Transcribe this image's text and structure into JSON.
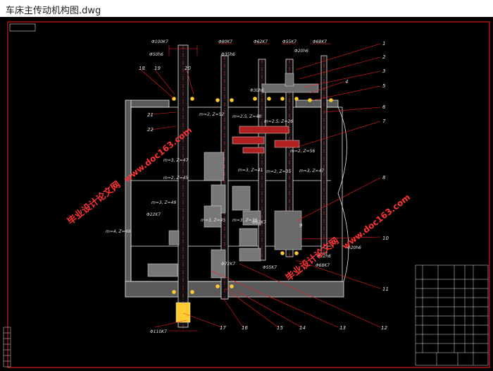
{
  "window": {
    "title": "车床主传动机构图.dwg"
  },
  "drawing": {
    "dims_top": [
      "Φ100K7",
      "Φ50h6",
      "Φ80K7",
      "Φ35h6",
      "Φ62K7",
      "Φ30h6",
      "Φ55K7",
      "Φ20h6",
      "Φ68K7"
    ],
    "dims_bottom": [
      "Φ22K7",
      "Φ62K7",
      "Φ72K7",
      "Φ55K7",
      "Φ22h6",
      "Φ68K7",
      "Φ20h6",
      "Φ110K7"
    ],
    "gear_labels": [
      "m=2, Z=52",
      "m=2.5, Z=48",
      "m=2.5, Z=26",
      "m=2, Z=56",
      "m=3, Z=47",
      "m=2, Z=45",
      "m=3, Z=41",
      "m=2, Z=35",
      "m=3, Z=47",
      "m=3, Z=49",
      "m=3, Z=45",
      "m=3, Z=36",
      "m=4, Z=48"
    ],
    "part_numbers_right": [
      "1",
      "2",
      "3",
      "4",
      "5",
      "6",
      "7",
      "8",
      "9",
      "10",
      "11"
    ],
    "part_numbers_bottom": [
      "12",
      "13",
      "14",
      "15",
      "16",
      "17",
      "18",
      "19",
      "20",
      "21",
      "22"
    ],
    "watermark_site": "www.doc163.com",
    "watermark_text": "毕业设计论文网",
    "colors": {
      "background": "#000000",
      "frame": "#ff2020",
      "watermark": "#ff3333",
      "line": "#e8e8e8"
    }
  }
}
